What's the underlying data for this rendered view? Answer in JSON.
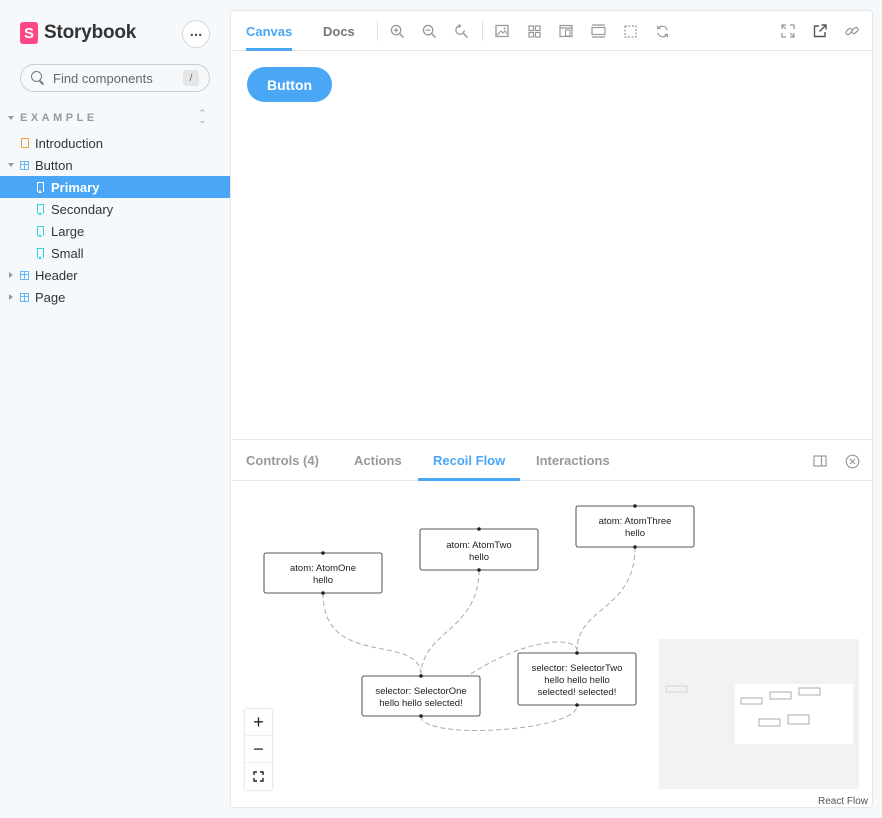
{
  "brand": {
    "name": "Storybook",
    "logo_letter": "S"
  },
  "search": {
    "placeholder": "Find components",
    "shortcut": "/"
  },
  "sidebar": {
    "group_title": "EXAMPLE",
    "items": [
      {
        "label": "Introduction",
        "icon": "document-icon"
      },
      {
        "label": "Button",
        "icon": "component-icon",
        "expanded": true
      },
      {
        "label": "Primary",
        "icon": "bookmark-icon",
        "selected": true
      },
      {
        "label": "Secondary",
        "icon": "bookmark-icon"
      },
      {
        "label": "Large",
        "icon": "bookmark-icon"
      },
      {
        "label": "Small",
        "icon": "bookmark-icon"
      },
      {
        "label": "Header",
        "icon": "component-icon",
        "expanded": false
      },
      {
        "label": "Page",
        "icon": "component-icon",
        "expanded": false
      }
    ]
  },
  "toolbar": {
    "tabs": [
      "Canvas",
      "Docs"
    ],
    "active_tab": "Canvas",
    "tools": [
      "zoom-in-icon",
      "zoom-out-icon",
      "zoom-reset-icon",
      "background-icon",
      "grid-icon",
      "viewport-icon",
      "measure-icon",
      "outline-icon",
      "remount-icon"
    ],
    "right_tools": [
      "fullscreen-icon",
      "open-new-tab-icon",
      "copy-link-icon"
    ]
  },
  "canvas": {
    "button_label": "Button"
  },
  "addons": {
    "tabs": [
      "Controls (4)",
      "Actions",
      "Recoil Flow",
      "Interactions"
    ],
    "active_tab": "Recoil Flow"
  },
  "flow": {
    "nodes": [
      {
        "id": "atom-one",
        "lines": [
          "atom: AtomOne",
          "hello"
        ]
      },
      {
        "id": "atom-two",
        "lines": [
          "atom: AtomTwo",
          "hello"
        ]
      },
      {
        "id": "atom-three",
        "lines": [
          "atom: AtomThree",
          "hello"
        ]
      },
      {
        "id": "selector-one",
        "lines": [
          "selector: SelectorOne",
          "hello hello selected!"
        ]
      },
      {
        "id": "selector-two",
        "lines": [
          "selector: SelectorTwo",
          "hello hello hello",
          "selected! selected!"
        ]
      }
    ],
    "zoom_controls": {
      "in": "+",
      "out": "−"
    },
    "attribution": "React Flow"
  },
  "colors": {
    "accent": "#4aa7f6",
    "brand": "#ff4785"
  }
}
